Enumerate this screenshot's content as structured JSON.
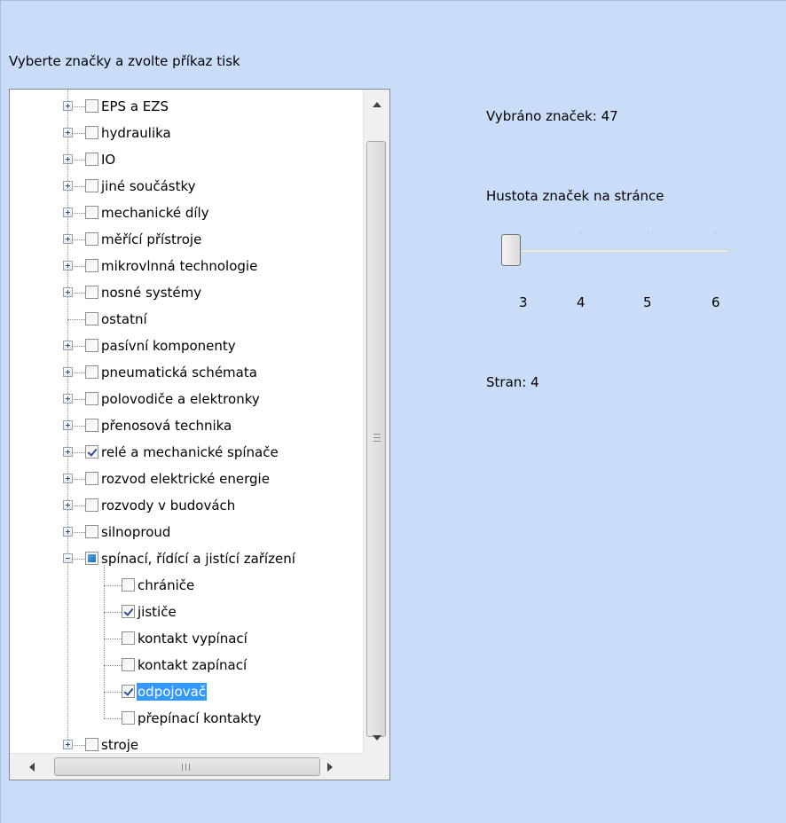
{
  "instruction": "Vyberte značky a zvolte příkaz tisk",
  "tree": {
    "items": [
      {
        "label": "EPS a EZS",
        "level": 0,
        "expanded": false,
        "expandable": true,
        "checkbox_state": "unchecked"
      },
      {
        "label": "hydraulika",
        "level": 0,
        "expanded": false,
        "expandable": true,
        "checkbox_state": "unchecked"
      },
      {
        "label": "IO",
        "level": 0,
        "expanded": false,
        "expandable": true,
        "checkbox_state": "unchecked"
      },
      {
        "label": "jiné součástky",
        "level": 0,
        "expanded": false,
        "expandable": true,
        "checkbox_state": "unchecked"
      },
      {
        "label": "mechanické díly",
        "level": 0,
        "expanded": false,
        "expandable": true,
        "checkbox_state": "unchecked"
      },
      {
        "label": "měřící přístroje",
        "level": 0,
        "expanded": false,
        "expandable": true,
        "checkbox_state": "unchecked"
      },
      {
        "label": "mikrovlnná technologie",
        "level": 0,
        "expanded": false,
        "expandable": true,
        "checkbox_state": "unchecked"
      },
      {
        "label": "nosné systémy",
        "level": 0,
        "expanded": false,
        "expandable": true,
        "checkbox_state": "unchecked"
      },
      {
        "label": "ostatní",
        "level": 0,
        "expanded": false,
        "expandable": false,
        "checkbox_state": "unchecked"
      },
      {
        "label": "pasívní komponenty",
        "level": 0,
        "expanded": false,
        "expandable": true,
        "checkbox_state": "unchecked"
      },
      {
        "label": "pneumatická schémata",
        "level": 0,
        "expanded": false,
        "expandable": true,
        "checkbox_state": "unchecked"
      },
      {
        "label": "polovodiče a elektronky",
        "level": 0,
        "expanded": false,
        "expandable": true,
        "checkbox_state": "unchecked"
      },
      {
        "label": "přenosová technika",
        "level": 0,
        "expanded": false,
        "expandable": true,
        "checkbox_state": "unchecked"
      },
      {
        "label": "relé a mechanické spínače",
        "level": 0,
        "expanded": false,
        "expandable": true,
        "checkbox_state": "checked"
      },
      {
        "label": "rozvod elektrické energie",
        "level": 0,
        "expanded": false,
        "expandable": true,
        "checkbox_state": "unchecked"
      },
      {
        "label": "rozvody v budovách",
        "level": 0,
        "expanded": false,
        "expandable": true,
        "checkbox_state": "unchecked"
      },
      {
        "label": "silnoproud",
        "level": 0,
        "expanded": false,
        "expandable": true,
        "checkbox_state": "unchecked"
      },
      {
        "label": "spínací, řídící a jistící zařízení",
        "level": 0,
        "expanded": true,
        "expandable": true,
        "checkbox_state": "partial"
      },
      {
        "label": "chrániče",
        "level": 1,
        "expanded": false,
        "expandable": false,
        "checkbox_state": "unchecked"
      },
      {
        "label": "jističe",
        "level": 1,
        "expanded": false,
        "expandable": false,
        "checkbox_state": "checked"
      },
      {
        "label": "kontakt vypínací",
        "level": 1,
        "expanded": false,
        "expandable": false,
        "checkbox_state": "unchecked"
      },
      {
        "label": "kontakt zapínací",
        "level": 1,
        "expanded": false,
        "expandable": false,
        "checkbox_state": "unchecked"
      },
      {
        "label": "odpojovač",
        "level": 1,
        "expanded": false,
        "expandable": false,
        "checkbox_state": "checked",
        "selected": true
      },
      {
        "label": "přepínací kontakty",
        "level": 1,
        "expanded": false,
        "expandable": false,
        "checkbox_state": "unchecked"
      },
      {
        "label": "stroje",
        "level": 0,
        "expanded": false,
        "expandable": true,
        "checkbox_state": "unchecked"
      }
    ],
    "hscroll_grip": "III"
  },
  "selected_count": {
    "label": "Vybráno značek:",
    "value": "47"
  },
  "density": {
    "label": "Hustota značek na stránce",
    "ticks": [
      "3",
      "4",
      "5",
      "6"
    ],
    "value": 3
  },
  "pages": {
    "label": "Stran:",
    "value": "4"
  },
  "colors": {
    "background": "#c9ddf9",
    "selection": "#3399ff",
    "check": "#2a4f9c"
  }
}
